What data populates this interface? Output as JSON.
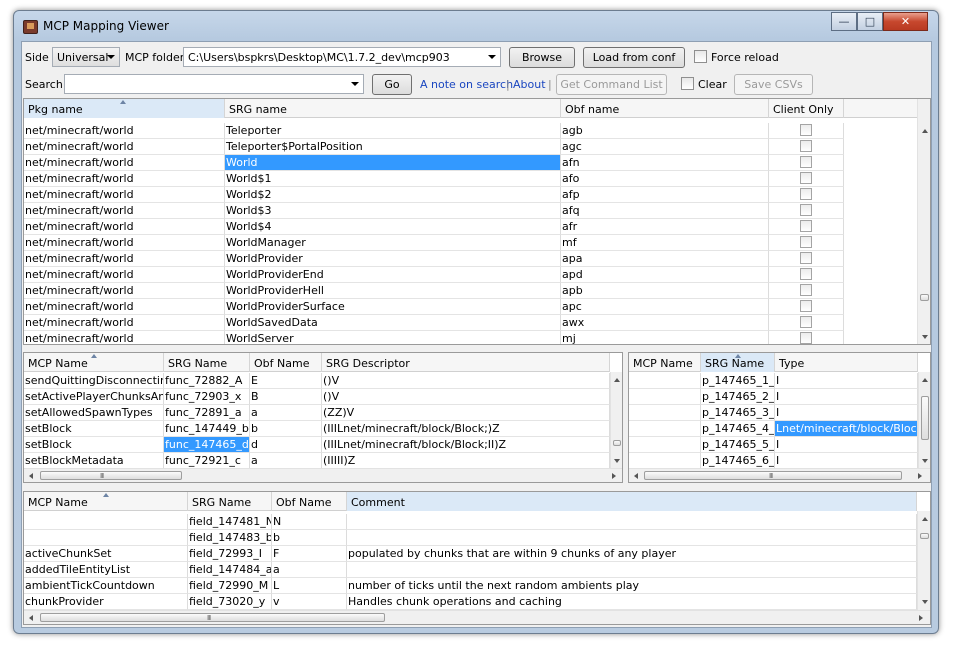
{
  "window": {
    "title": "MCP Mapping Viewer",
    "minimize": "—",
    "maximize": "□",
    "close": "✕"
  },
  "toolbar": {
    "side_label": "Side",
    "side_value": "Universal",
    "folder_label": "MCP folder",
    "folder_value": "C:\\Users\\bspkrs\\Desktop\\MC\\1.7.2_dev\\mcp903",
    "browse": "Browse",
    "load": "Load from conf",
    "force_reload": "Force reload",
    "search_label": "Search",
    "search_value": "",
    "go": "Go",
    "note_link": "A note on search",
    "separator": "|",
    "about_link": "About",
    "get_commands": "Get Command List",
    "clear": "Clear",
    "save_csvs": "Save CSVs"
  },
  "classes": {
    "headers": [
      "Pkg name",
      "SRG name",
      "Obf name",
      "Client Only"
    ],
    "rows": [
      [
        "net/minecraft/world",
        "Teleporter",
        "agb"
      ],
      [
        "net/minecraft/world",
        "Teleporter$PortalPosition",
        "agc"
      ],
      [
        "net/minecraft/world",
        "World",
        "afn"
      ],
      [
        "net/minecraft/world",
        "World$1",
        "afo"
      ],
      [
        "net/minecraft/world",
        "World$2",
        "afp"
      ],
      [
        "net/minecraft/world",
        "World$3",
        "afq"
      ],
      [
        "net/minecraft/world",
        "World$4",
        "afr"
      ],
      [
        "net/minecraft/world",
        "WorldManager",
        "mf"
      ],
      [
        "net/minecraft/world",
        "WorldProvider",
        "apa"
      ],
      [
        "net/minecraft/world",
        "WorldProviderEnd",
        "apd"
      ],
      [
        "net/minecraft/world",
        "WorldProviderHell",
        "apb"
      ],
      [
        "net/minecraft/world",
        "WorldProviderSurface",
        "apc"
      ],
      [
        "net/minecraft/world",
        "WorldSavedData",
        "awx"
      ],
      [
        "net/minecraft/world",
        "WorldServer",
        "mj"
      ]
    ]
  },
  "methods": {
    "headers": [
      "MCP Name",
      "SRG Name",
      "Obf Name",
      "SRG Descriptor"
    ],
    "rows": [
      [
        "sendQuittingDisconnectin...",
        "func_72882_A",
        "E",
        "()V"
      ],
      [
        "setActivePlayerChunksAn...",
        "func_72903_x",
        "B",
        "()V"
      ],
      [
        "setAllowedSpawnTypes",
        "func_72891_a",
        "a",
        "(ZZ)V"
      ],
      [
        "setBlock",
        "func_147449_b",
        "b",
        "(IIILnet/minecraft/block/Block;)Z"
      ],
      [
        "setBlock",
        "func_147465_d",
        "d",
        "(IIILnet/minecraft/block/Block;II)Z"
      ],
      [
        "setBlockMetadata",
        "func_72921_c",
        "a",
        "(IIIII)Z"
      ]
    ],
    "grip": "III"
  },
  "params": {
    "headers": [
      "MCP Name",
      "SRG Name",
      "Type"
    ],
    "rows": [
      [
        "",
        "p_147465_1_",
        "I"
      ],
      [
        "",
        "p_147465_2_",
        "I"
      ],
      [
        "",
        "p_147465_3_",
        "I"
      ],
      [
        "",
        "p_147465_4_",
        "Lnet/minecraft/block/Block;"
      ],
      [
        "",
        "p_147465_5_",
        "I"
      ],
      [
        "",
        "p_147465_6_",
        "I"
      ]
    ],
    "grip": "III"
  },
  "fields": {
    "headers": [
      "MCP Name",
      "SRG Name",
      "Obf Name",
      "Comment"
    ],
    "rows": [
      [
        "",
        "field_147481_N",
        "N",
        ""
      ],
      [
        "",
        "field_147483_b",
        "b",
        ""
      ],
      [
        "activeChunkSet",
        "field_72993_I",
        "F",
        "populated by chunks that are within 9 chunks of any player"
      ],
      [
        "addedTileEntityList",
        "field_147484_a",
        "a",
        ""
      ],
      [
        "ambientTickCountdown",
        "field_72990_M",
        "L",
        "number of ticks until the next random ambients play"
      ],
      [
        "chunkProvider",
        "field_73020_y",
        "v",
        "Handles chunk operations and caching"
      ]
    ],
    "grip": "III"
  },
  "colors": {
    "selection": "#3399ff",
    "sorted_header": "#dbe9f7",
    "link": "#1a46c0"
  }
}
